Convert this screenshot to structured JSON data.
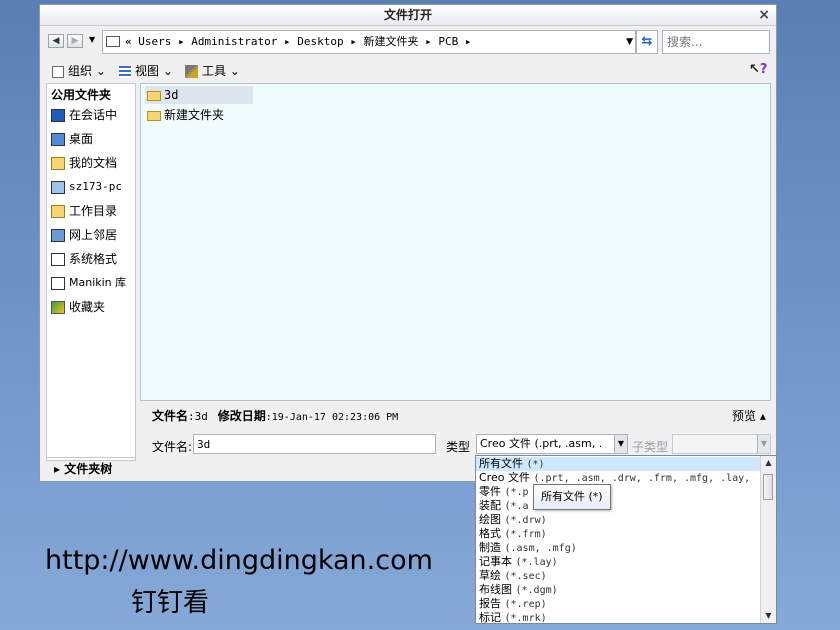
{
  "window": {
    "title": "文件打开",
    "close_glyph": "×"
  },
  "nav": {
    "back_glyph": "◀",
    "forward_glyph": "▶",
    "dropdown_glyph": "▼",
    "path_chevron": "«",
    "path": [
      "Users",
      "Administrator",
      "Desktop",
      "新建文件夹",
      "PCB"
    ],
    "path_sep": "▸",
    "search_placeholder": "搜索..."
  },
  "toolbar": {
    "organize": "组织 ⌄",
    "views": "视图 ⌄",
    "tools": "工具 ⌄",
    "help": "?"
  },
  "sidebar": {
    "heading": "公用文件夹",
    "items": [
      {
        "label": "在会话中",
        "icon": "monitor-icon"
      },
      {
        "label": "桌面",
        "icon": "desktop-icon"
      },
      {
        "label": "我的文档",
        "icon": "documents-icon"
      },
      {
        "label": "sz173-pc",
        "icon": "computer-icon"
      },
      {
        "label": "工作目录",
        "icon": "work-folder-icon"
      },
      {
        "label": "网上邻居",
        "icon": "network-icon"
      },
      {
        "label": "系统格式",
        "icon": "system-format-icon"
      },
      {
        "label": "Manikin 库",
        "icon": "manikin-library-icon"
      },
      {
        "label": "收藏夹",
        "icon": "favorites-icon"
      }
    ],
    "folder_tree": "▸ 文件夹树"
  },
  "files": [
    {
      "name": "3d",
      "selected": true
    },
    {
      "name": "新建文件夹",
      "selected": false
    }
  ],
  "info": {
    "filename_label": "文件名",
    "filename_value": ":3d",
    "date_label": "修改日期",
    "date_value": ":19-Jan-17 02:23:06 PM",
    "preview": "预览 ▴"
  },
  "form": {
    "filename_label": "文件名:",
    "filename_value": "3d",
    "type_label": "类型",
    "type_value": "Creo 文件 (.prt, .asm, .",
    "subtype_label": "子类型"
  },
  "type_options": [
    {
      "name": "所有文件",
      "ext": "(*)",
      "selected": true
    },
    {
      "name": "Creo 文件",
      "ext": "(.prt, .asm, .drw, .frm, .mfg, .lay,",
      "selected": false
    },
    {
      "name": "零件",
      "ext": "(*.p",
      "selected": false
    },
    {
      "name": "装配",
      "ext": "(*.a",
      "selected": false
    },
    {
      "name": "绘图",
      "ext": "(*.drw)",
      "selected": false
    },
    {
      "name": "格式",
      "ext": "(*.frm)",
      "selected": false
    },
    {
      "name": "制造",
      "ext": "(.asm, .mfg)",
      "selected": false
    },
    {
      "name": "记事本",
      "ext": "(*.lay)",
      "selected": false
    },
    {
      "name": "草绘",
      "ext": "(*.sec)",
      "selected": false
    },
    {
      "name": "布线图",
      "ext": "(*.dgm)",
      "selected": false
    },
    {
      "name": "报告",
      "ext": "(*.rep)",
      "selected": false
    },
    {
      "name": "标记",
      "ext": "(*.mrk)",
      "selected": false
    }
  ],
  "tooltip": "所有文件 (*)",
  "watermark": {
    "url": "http://www.dingdingkan.com",
    "cn": "钉钉看"
  },
  "colors": {
    "selection": "#cde8ff",
    "file_area": "#f0fbfd",
    "background": "#6d92c6"
  }
}
